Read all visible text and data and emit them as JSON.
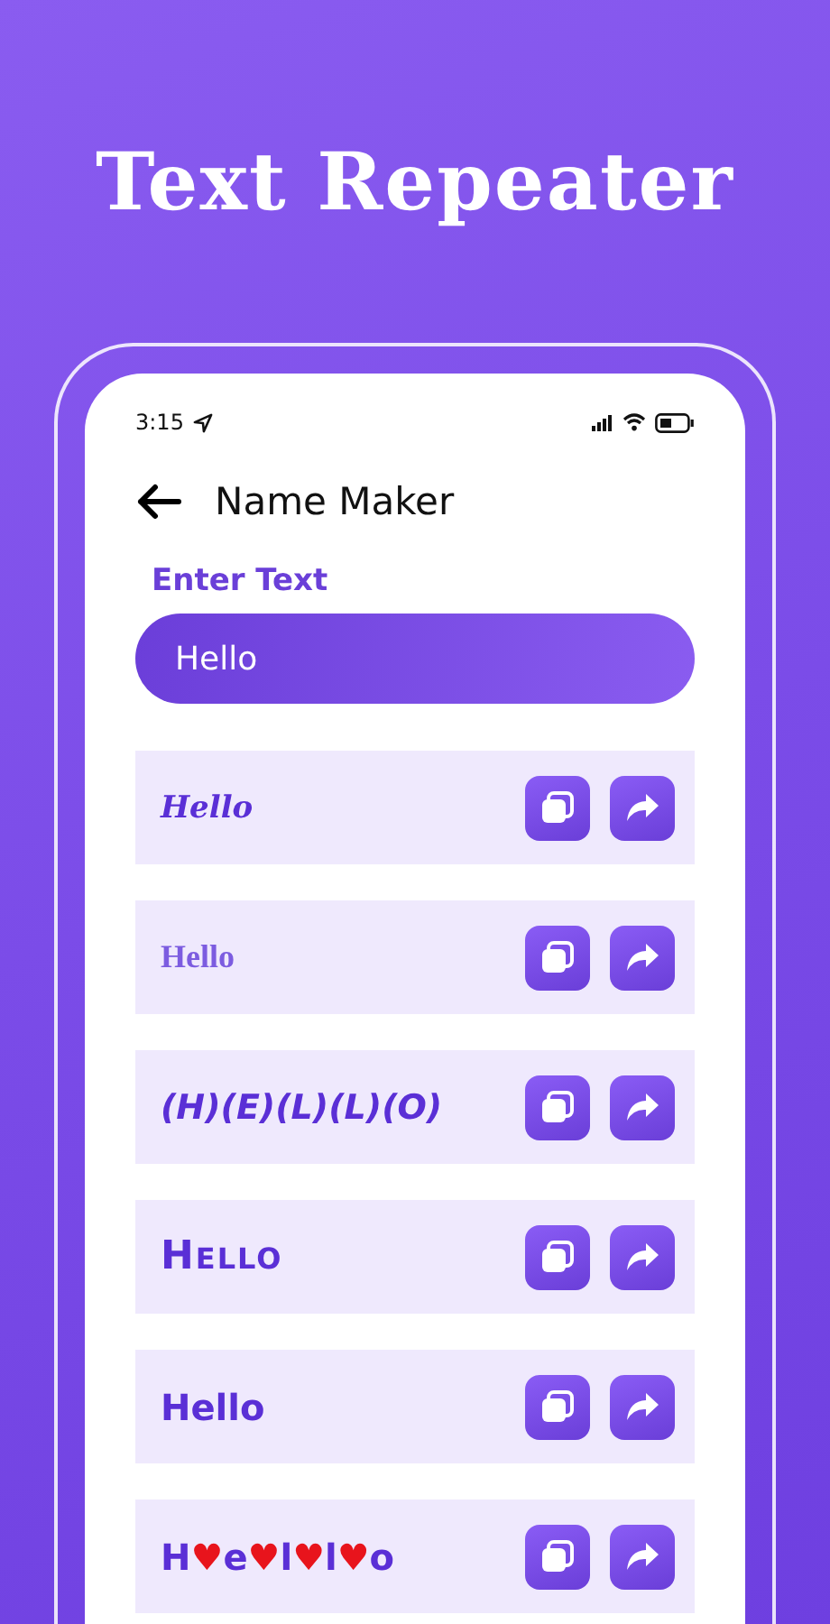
{
  "headline": "Text Repeater",
  "status_bar": {
    "time": "3:15"
  },
  "header": {
    "title": "Name Maker"
  },
  "input": {
    "label": "Enter Text",
    "value": "Hello"
  },
  "results": [
    {
      "kind": "script",
      "parts": [
        {
          "text": "Hello"
        }
      ]
    },
    {
      "kind": "serif",
      "parts": [
        {
          "text": "Hello"
        }
      ]
    },
    {
      "kind": "italic",
      "parts": [
        {
          "text": "(H)(E)(L)(L)(O)"
        }
      ]
    },
    {
      "kind": "smallcaps",
      "parts": [
        {
          "text": "HELLO"
        }
      ]
    },
    {
      "kind": "plain",
      "parts": [
        {
          "text": "Hello"
        }
      ]
    },
    {
      "kind": "plain",
      "parts": [
        {
          "text": "H"
        },
        {
          "text": "♥",
          "kind": "heart"
        },
        {
          "text": "e"
        },
        {
          "text": "♥",
          "kind": "heart"
        },
        {
          "text": "l"
        },
        {
          "text": "♥",
          "kind": "heart"
        },
        {
          "text": "l"
        },
        {
          "text": "♥",
          "kind": "heart"
        },
        {
          "text": "o"
        }
      ]
    }
  ]
}
